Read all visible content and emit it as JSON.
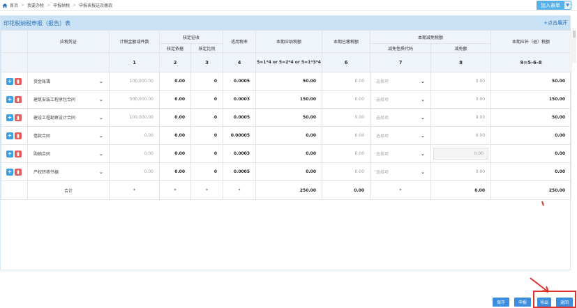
{
  "breadcrumb": [
    "首页",
    "我要办税",
    "申报纳税",
    "申报表报送及缴款"
  ],
  "add_report_label": "加入表单",
  "panel": {
    "title": "印花税纳税申报（报告）表",
    "toggle": "+点击展开"
  },
  "headers": {
    "voucher": "应税凭证",
    "amount": "计税金额或件数",
    "verified": "核定征收",
    "verified_basis": "核定依据",
    "verified_ratio": "核定比例",
    "rate": "适用税率",
    "tax_payable": "本期应纳税额",
    "tax_paid": "本期已缴税额",
    "reduction": "本期减免税额",
    "reduction_code": "减免性质代码",
    "reduction_amount": "减免额",
    "tax_due": "本期应补（退）税额",
    "col1": "1",
    "col2": "2",
    "col3": "3",
    "col4": "4",
    "col5": "5=1*4 or 5=2*4 or 5=1*3*4",
    "col6": "6",
    "col7": "7",
    "col8": "8",
    "col9": "9=5-6-8"
  },
  "rows": [
    {
      "voucher": "资金账簿",
      "amount": "100,000.00",
      "basis": "0.00",
      "ratio": "0",
      "rate": "0.0005",
      "payable": "50.00",
      "paid": "0.00",
      "code": "选择项",
      "reduction": "0.00",
      "due": "50.00"
    },
    {
      "voucher": "建筑安装工程承包合同",
      "amount": "500,000.00",
      "basis": "0.00",
      "ratio": "0",
      "rate": "0.0003",
      "payable": "150.00",
      "paid": "0.00",
      "code": "选择项",
      "reduction": "0.00",
      "due": "150.00"
    },
    {
      "voucher": "建设工程勘察设计合同",
      "amount": "100,000.00",
      "basis": "0.00",
      "ratio": "0",
      "rate": "0.0005",
      "payable": "50.00",
      "paid": "0.00",
      "code": "选择项",
      "reduction": "0.00",
      "due": "50.00"
    },
    {
      "voucher": "借款合同",
      "amount": "0.00",
      "basis": "0.00",
      "ratio": "0",
      "rate": "0.00005",
      "payable": "0.00",
      "paid": "0.00",
      "code": "选择项",
      "reduction": "0.00",
      "due": "0.00"
    },
    {
      "voucher": "购销合同",
      "amount": "0.00",
      "basis": "0.00",
      "ratio": "0",
      "rate": "0.0003",
      "payable": "0.00",
      "paid": "0.00",
      "code": "选择项",
      "reduction": "0.00",
      "due": "0.00"
    },
    {
      "voucher": "产权转移书据",
      "amount": "0.00",
      "basis": "0.00",
      "ratio": "0",
      "rate": "0.0005",
      "payable": "0.00",
      "paid": "0.00",
      "code": "选择项",
      "reduction": "0.00",
      "due": "0.00"
    }
  ],
  "total": {
    "label": "合计",
    "amount": "*",
    "basis": "*",
    "ratio": "*",
    "rate": "*",
    "payable": "250.00",
    "paid": "0.00",
    "code": "*",
    "reduction": "0.00",
    "due": "250.00"
  },
  "footer": {
    "save": "保存",
    "declare": "申报",
    "export": "导出",
    "back": "返回"
  },
  "colors": {
    "accent": "#3c8ddc",
    "panel_head": "#c9e2f6",
    "highlight": "#e0312f"
  }
}
